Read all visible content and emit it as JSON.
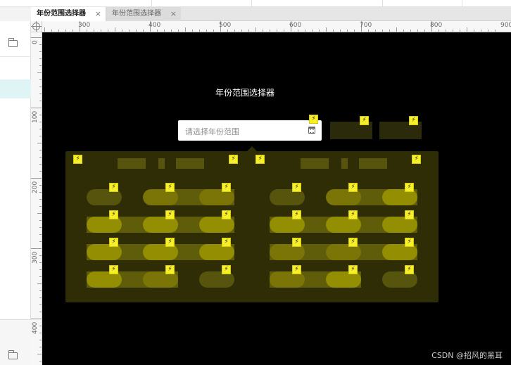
{
  "tabs": [
    {
      "label": "年份范围选择器",
      "active": true
    },
    {
      "label": "年份范围选择器",
      "active": false
    }
  ],
  "close_glyph": "×",
  "ruler": {
    "h_labels": [
      "300",
      "400",
      "500",
      "600",
      "700",
      "800",
      "900"
    ],
    "v_labels": [
      "0",
      "100",
      "200",
      "300",
      "400"
    ]
  },
  "canvas": {
    "title": "年份范围选择器",
    "picker": {
      "placeholder": "请选择年份范围",
      "icon": "calendar-icon"
    },
    "bolt_glyph": "⚡"
  },
  "colors": {
    "canvas_bg": "#000000",
    "panel_bg": "#2e2d06",
    "cell_dim": "#57540d",
    "cell_mid": "#7a7506",
    "cell_bright": "#948e03",
    "bolt": "#f6ef2c"
  },
  "left_panel": {
    "icons": [
      "folder-icon",
      "folder-icon"
    ]
  },
  "watermark": "CSDN @招风的黑耳"
}
